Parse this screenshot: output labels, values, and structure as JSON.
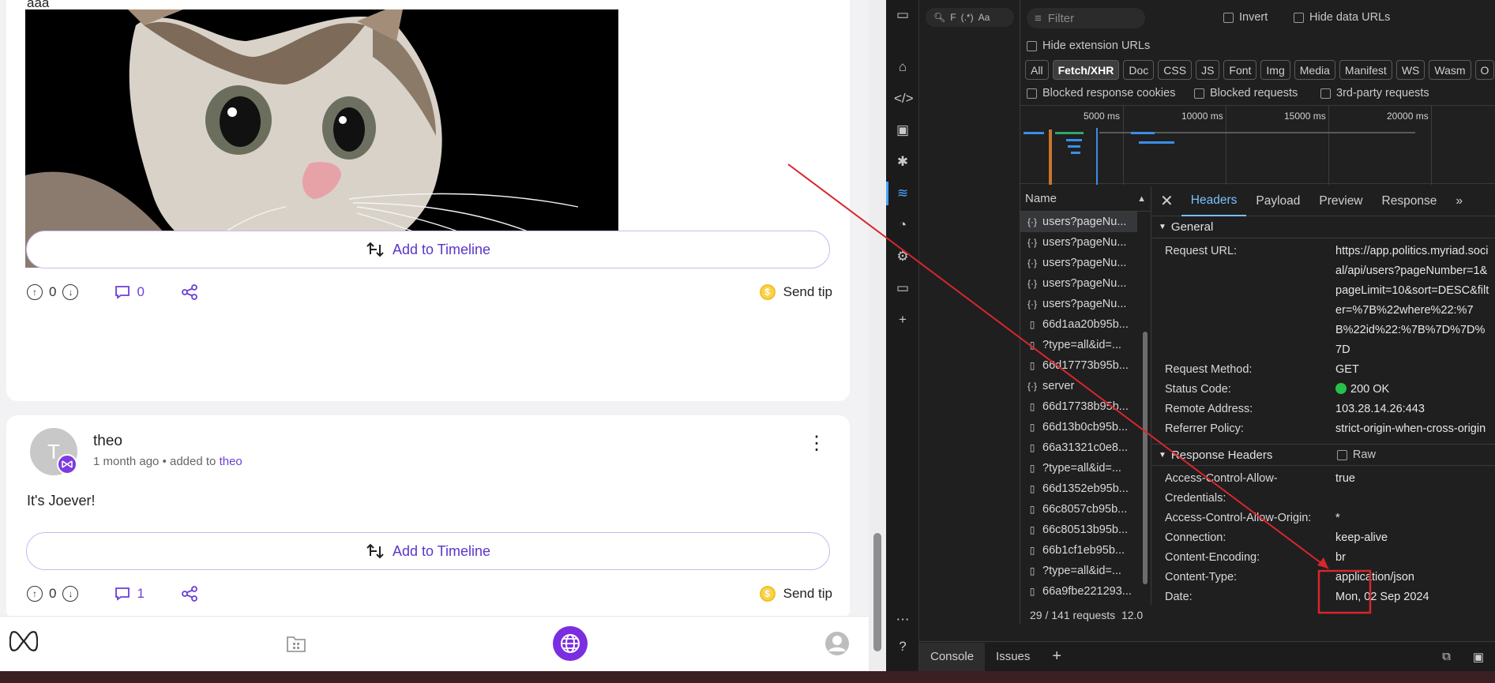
{
  "post1": {
    "cut_text": "aaa",
    "timeline_label": "Add to Timeline",
    "votes": "0",
    "comments": "0",
    "tip_label": "Send tip"
  },
  "post2": {
    "avatar_letter": "T",
    "author": "theo",
    "time": "1 month ago",
    "added_to": "• added to",
    "added_link": "theo",
    "text": "It's Joever!",
    "timeline_label": "Add to Timeline",
    "votes": "0",
    "comments": "1",
    "tip_label": "Send tip"
  },
  "devtools": {
    "search_placeholder": "F",
    "search_regex": "(.*)",
    "search_case": "Aa",
    "filter_placeholder": "Filter",
    "invert": "Invert",
    "hide_data_urls": "Hide data URLs",
    "hide_extension_urls": "Hide extension URLs",
    "types": [
      "All",
      "Fetch/XHR",
      "Doc",
      "CSS",
      "JS",
      "Font",
      "Img",
      "Media",
      "Manifest",
      "WS",
      "Wasm",
      "O"
    ],
    "blocked_cookies": "Blocked response cookies",
    "blocked_requests": "Blocked requests",
    "third_party": "3rd-party requests",
    "timeline_ticks": [
      "5000 ms",
      "10000 ms",
      "15000 ms",
      "20000 ms"
    ],
    "list_header": "Name",
    "requests": [
      {
        "icon": "xhr",
        "name": "users?pageNu..."
      },
      {
        "icon": "xhr",
        "name": "users?pageNu..."
      },
      {
        "icon": "xhr",
        "name": "users?pageNu..."
      },
      {
        "icon": "xhr",
        "name": "users?pageNu..."
      },
      {
        "icon": "xhr",
        "name": "users?pageNu..."
      },
      {
        "icon": "doc",
        "name": "66d1aa20b95b..."
      },
      {
        "icon": "doc",
        "name": "?type=all&id=..."
      },
      {
        "icon": "doc",
        "name": "66d17773b95b..."
      },
      {
        "icon": "xhr",
        "name": "server"
      },
      {
        "icon": "doc",
        "name": "66d17738b95b..."
      },
      {
        "icon": "doc",
        "name": "66d13b0cb95b..."
      },
      {
        "icon": "doc",
        "name": "66a31321c0e8..."
      },
      {
        "icon": "doc",
        "name": "?type=all&id=..."
      },
      {
        "icon": "doc",
        "name": "66d1352eb95b..."
      },
      {
        "icon": "doc",
        "name": "66c8057cb95b..."
      },
      {
        "icon": "doc",
        "name": "66c80513b95b..."
      },
      {
        "icon": "doc",
        "name": "66b1cf1eb95b..."
      },
      {
        "icon": "doc",
        "name": "?type=all&id=..."
      },
      {
        "icon": "doc",
        "name": "66a9fbe221293..."
      }
    ],
    "status_text": "29 / 141 requests",
    "status_extra": "12.0",
    "tabs": [
      "Headers",
      "Payload",
      "Preview",
      "Response"
    ],
    "general_label": "General",
    "general": [
      {
        "k": "Request URL:",
        "v": "https://app.politics.myriad.social/api/users?pageNumber=1&pageLimit=10&sort=DESC&filter=%7B%22where%22:%7B%22id%22:%7B%7D%7D%7D"
      },
      {
        "k": "Request Method:",
        "v": "GET"
      },
      {
        "k": "Status Code:",
        "v": "200 OK"
      },
      {
        "k": "Remote Address:",
        "v": "103.28.14.26:443"
      },
      {
        "k": "Referrer Policy:",
        "v": "strict-origin-when-cross-origin"
      }
    ],
    "response_headers_label": "Response Headers",
    "raw_label": "Raw",
    "response_headers": [
      {
        "k": "Access-Control-Allow-Credentials:",
        "v": "true"
      },
      {
        "k": "Access-Control-Allow-Origin:",
        "v": "*"
      },
      {
        "k": "Connection:",
        "v": "keep-alive"
      },
      {
        "k": "Content-Encoding:",
        "v": "br"
      },
      {
        "k": "Content-Type:",
        "v": "application/json"
      },
      {
        "k": "Date:",
        "v": "Mon, 02 Sep 2024"
      }
    ],
    "drawer_tabs": [
      "Console",
      "Issues"
    ]
  },
  "colors": {
    "accent": "#6c3fd6",
    "devtools_blue": "#7cc0ff",
    "annotation_red": "#d8262c"
  }
}
